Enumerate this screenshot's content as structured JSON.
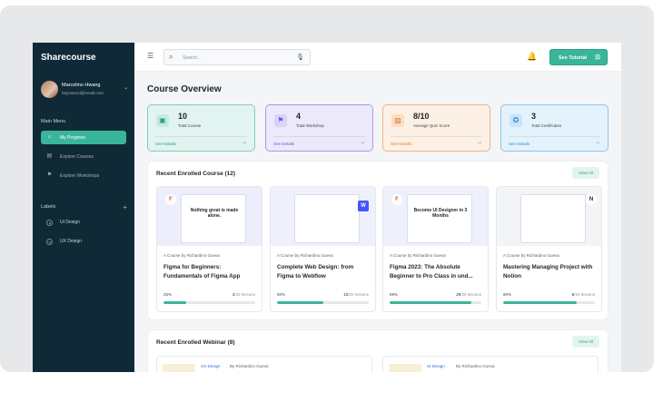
{
  "app": {
    "brand": "Sharecourse"
  },
  "user": {
    "name": "Marcelino Hwang",
    "email": "heymarcel@email.com"
  },
  "sidebar": {
    "main_menu_title": "Main Menu",
    "items": [
      {
        "label": "My Progress",
        "icon": "home-icon",
        "active": true
      },
      {
        "label": "Explore Courses",
        "icon": "book-icon",
        "active": false
      },
      {
        "label": "Explore Workshops",
        "icon": "flag-icon",
        "active": false
      }
    ],
    "labels_title": "Labels",
    "labels": [
      {
        "label": "UI Design"
      },
      {
        "label": "UX Design"
      }
    ]
  },
  "topbar": {
    "search_placeholder": "Search...",
    "tutorial_label": "See Tutorial"
  },
  "main": {
    "title": "Course Overview",
    "stats": [
      {
        "value": "10",
        "caption": "Total Course",
        "link": "See Details",
        "color": "#e2f4ef",
        "border": "#7fd0bb",
        "icon_bg": "#c5ebe1",
        "icon_fg": "#2e9c84",
        "link_color": "#2e9c84"
      },
      {
        "value": "4",
        "caption": "Total Workshop",
        "link": "See Details",
        "color": "#ece9fb",
        "border": "#a99be8",
        "icon_bg": "#d9d3f7",
        "icon_fg": "#6c56d6",
        "link_color": "#6c56d6"
      },
      {
        "value": "8/10",
        "caption": "Average Quiz Score",
        "link": "See Details",
        "color": "#fdf0e4",
        "border": "#f1b487",
        "icon_bg": "#fbdcc4",
        "icon_fg": "#e07a2e",
        "link_color": "#e07a2e"
      },
      {
        "value": "3",
        "caption": "Total Certificates",
        "link": "See Details",
        "color": "#e4f2fc",
        "border": "#8cc6ef",
        "icon_bg": "#c8e5f9",
        "icon_fg": "#2a8bd0",
        "link_color": "#2a8bd0"
      }
    ],
    "recent_courses": {
      "title": "Recent Enrolled Course (12)",
      "view_all": "View All",
      "courses": [
        {
          "author": "A Course by Richardino Gueva",
          "title": "Figma for Beginners: Fundamentals of Figma App",
          "percent": "25%",
          "progress": 0.25,
          "done": "4",
          "total": "/20 lessons",
          "thumb_text": "Nothing great is made alone."
        },
        {
          "author": "A Course by Richardino Gueva",
          "title": "Complete Web Design: from Figma to Webflow",
          "percent": "50%",
          "progress": 0.5,
          "done": "10",
          "total": "/20 lessons",
          "thumb_text": ""
        },
        {
          "author": "A Course by Richardino Gueva",
          "title": "Figma 2023: The Absolute Beginner to Pro Class in und...",
          "percent": "89%",
          "progress": 0.89,
          "done": "29",
          "total": "/30 lessons",
          "thumb_text": "Become UI Designer in 3 Months"
        },
        {
          "author": "A Course by Richardino Gueva",
          "title": "Mastering Managing Project with Notion",
          "percent": "80%",
          "progress": 0.8,
          "done": "8",
          "total": "/10 lessons",
          "thumb_text": ""
        }
      ]
    },
    "recent_webinars": {
      "title": "Recent Enrolled Webinar (8)",
      "view_all": "View All",
      "webinars": [
        {
          "tag": "UX Design",
          "author": "By Richardino Gueva"
        },
        {
          "tag": "UI Design",
          "author": "By Richardino Gueva"
        }
      ]
    }
  }
}
